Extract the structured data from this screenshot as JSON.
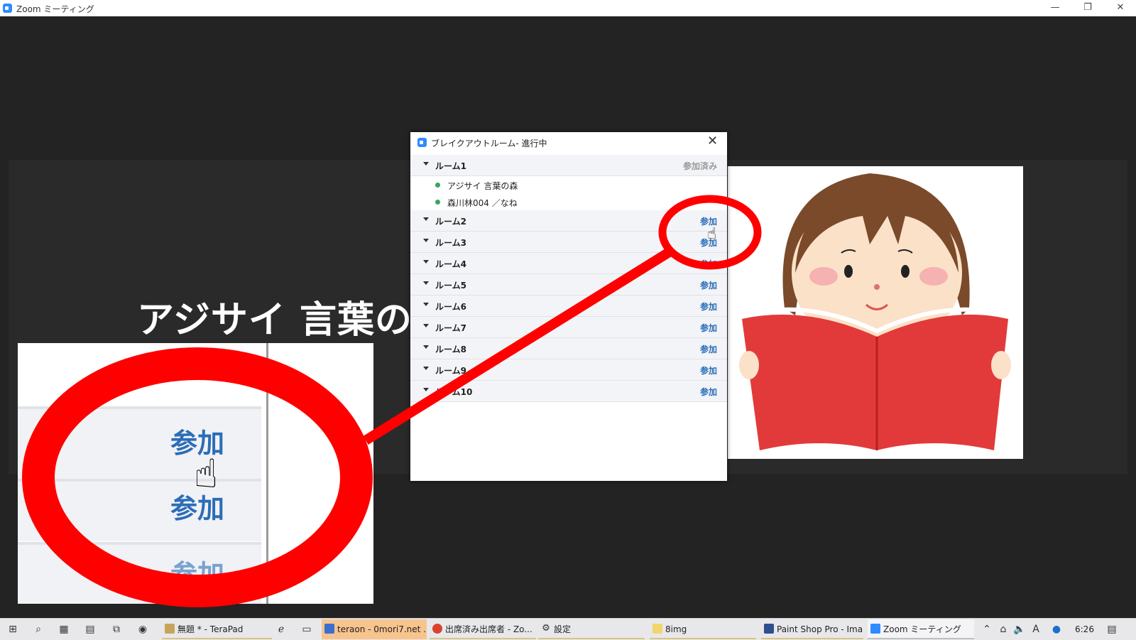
{
  "window": {
    "title": "Zoom ミーティング",
    "minimize": "—",
    "restore": "❐",
    "close": "✕"
  },
  "meeting": {
    "speaker_name": "アジサイ 言葉の森"
  },
  "zoom_inset": {
    "join_label": "参加",
    "join_label_partial": "参加"
  },
  "dialog": {
    "title": "ブレイクアウトルーム- 進行中",
    "close": "✕",
    "rooms": [
      {
        "name": "ルーム1",
        "action": "参加済み"
      },
      {
        "name": "ルーム2",
        "action": "参加"
      },
      {
        "name": "ルーム3",
        "action": "参加"
      },
      {
        "name": "ルーム4",
        "action": "参加"
      },
      {
        "name": "ルーム5",
        "action": "参加"
      },
      {
        "name": "ルーム6",
        "action": "参加"
      },
      {
        "name": "ルーム7",
        "action": "参加"
      },
      {
        "name": "ルーム8",
        "action": "参加"
      },
      {
        "name": "ルーム9",
        "action": "参加"
      },
      {
        "name": "ルーム10",
        "action": "参加"
      }
    ],
    "members": [
      "アジサイ 言葉の森",
      "森川林004 ／なね"
    ]
  },
  "taskbar": {
    "apps": [
      {
        "label": "無題 * - TeraPad",
        "icon": "terapad-icon"
      },
      {
        "label": "",
        "icon": "ie-icon"
      },
      {
        "label": "",
        "icon": "window-icon"
      },
      {
        "label": "teraon - 0mori7.net ...",
        "icon": "ftp-icon"
      },
      {
        "label": "出席済み出席者 - Zo...",
        "icon": "chrome-icon"
      },
      {
        "label": "設定",
        "icon": "gear-icon"
      },
      {
        "label": "8img",
        "icon": "folder-icon"
      },
      {
        "label": "Paint Shop Pro - Ima...",
        "icon": "paintshop-icon"
      },
      {
        "label": "Zoom ミーティング",
        "icon": "zoom-icon"
      }
    ],
    "clock": "6:26"
  },
  "colors": {
    "accent": "#2b6db8",
    "annotation": "#ff0000",
    "background": "#232323"
  }
}
